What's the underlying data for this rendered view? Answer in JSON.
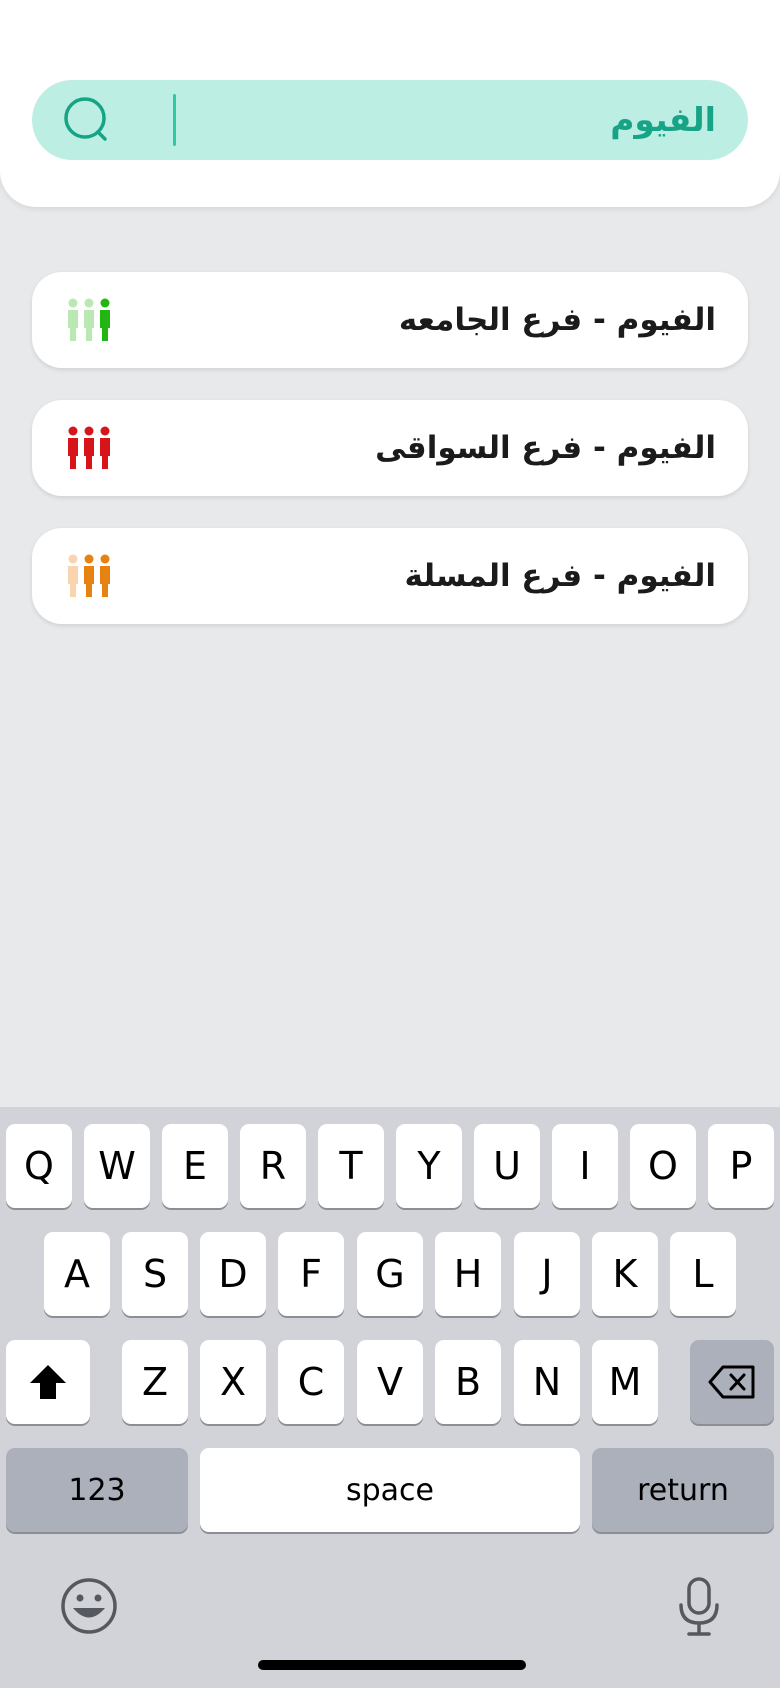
{
  "search": {
    "value": "الفيوم"
  },
  "results": [
    {
      "label": "الفيوم - فرع الجامعه",
      "crowd_level": 1,
      "crowd_level_max": 3,
      "crowd_color": "#22b613",
      "crowd_light_color": "#b9e8b3"
    },
    {
      "label": "الفيوم - فرع السواقى",
      "crowd_level": 3,
      "crowd_level_max": 3,
      "crowd_color": "#d6141a",
      "crowd_light_color": "#f3b4b5"
    },
    {
      "label": "الفيوم - فرع المسلة",
      "crowd_level": 2,
      "crowd_level_max": 3,
      "crowd_color": "#e7810f",
      "crowd_light_color": "#f9d4ae"
    }
  ],
  "keyboard": {
    "row1": [
      "Q",
      "W",
      "E",
      "R",
      "T",
      "Y",
      "U",
      "I",
      "O",
      "P"
    ],
    "row2": [
      "A",
      "S",
      "D",
      "F",
      "G",
      "H",
      "J",
      "K",
      "L"
    ],
    "row3": [
      "Z",
      "X",
      "C",
      "V",
      "B",
      "N",
      "M"
    ],
    "numbers_label": "123",
    "space_label": "space",
    "return_label": "return"
  },
  "colors": {
    "accent": "#17a486",
    "search_bg": "#bdeee3"
  }
}
